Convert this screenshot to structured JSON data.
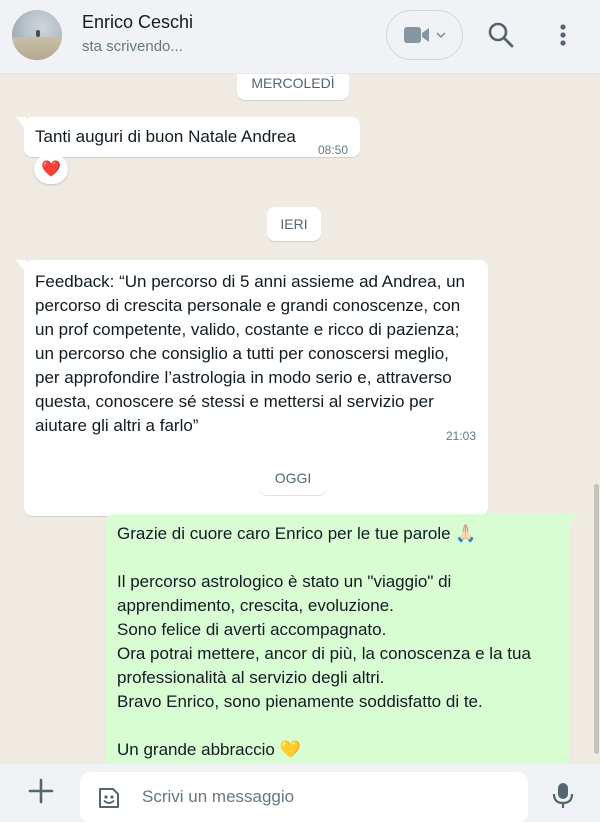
{
  "header": {
    "contact_name": "Enrico Ceschi",
    "status": "sta scrivendo..."
  },
  "icons": {
    "video": "video-camera-icon",
    "search": "search-icon",
    "menu": "more-vertical-icon",
    "add": "plus-icon",
    "sticker": "sticker-icon",
    "mic": "microphone-icon"
  },
  "colors": {
    "incoming_bubble": "#ffffff",
    "outgoing_bubble": "#d9fdd3",
    "chat_background": "#efeae2"
  },
  "chat": {
    "day_wednesday": "MERCOLEDÌ",
    "msg1": {
      "text": "Tanti auguri di buon Natale Andrea",
      "time": "08:50",
      "reaction": "❤️"
    },
    "day_yesterday": "IERI",
    "msg2": {
      "text": "Feedback: “Un percorso di 5 anni assieme ad Andrea, un\npercorso di crescita personale e grandi conoscenze, con\nun prof competente, valido, costante e ricco di pazienza;\nun percorso che consiglio a tutti per conoscersi meglio,\nper approfondire l’astrologia in modo serio e, attraverso\nquesta, conoscere sé stessi e mettersi al servizio per\naiutare gli altri a farlo”",
      "time": "21:03"
    },
    "day_today": "OGGI",
    "msg3": {
      "text": "Grazie di cuore caro Enrico per le tue parole 🙏🏻\n\nIl percorso astrologico è stato un \"viaggio\" di\napprendimento, crescita, evoluzione.\nSono felice di averti accompagnato.\nOra potrai mettere, ancor di più, la conoscenza e la tua\nprofessionalità al servizio degli altri.\nBravo Enrico, sono pienamente soddisfatto di te.\n\nUn grande abbraccio 💛"
    }
  },
  "composer": {
    "placeholder": "Scrivi un messaggio"
  }
}
